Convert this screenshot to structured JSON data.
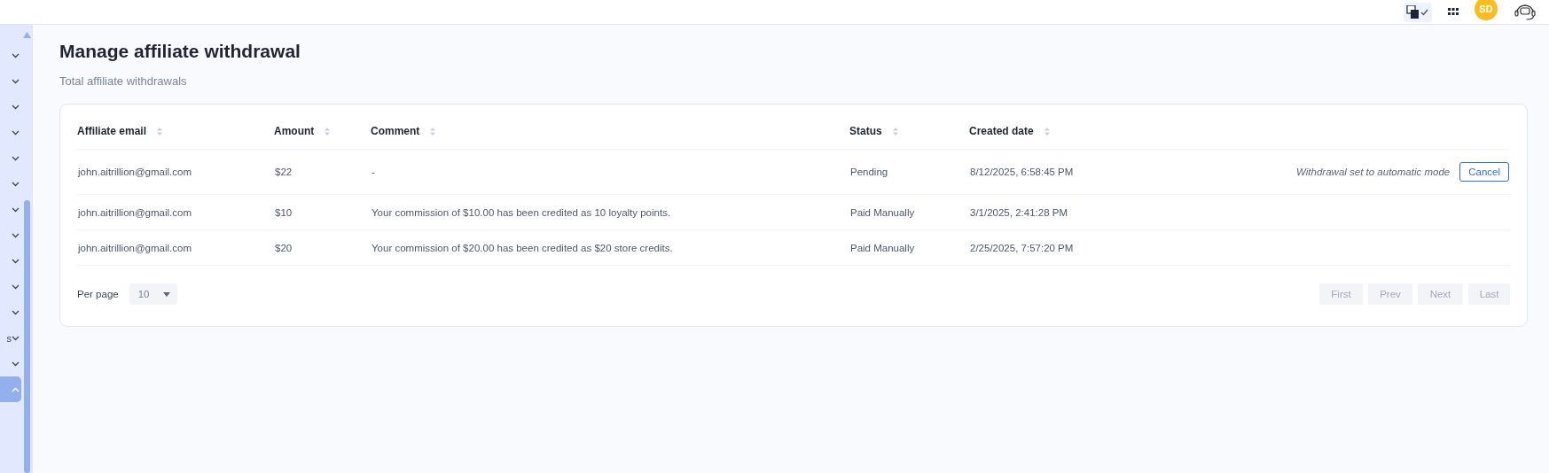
{
  "topbar": {
    "avatar": "SD"
  },
  "sidebar": {
    "items": [
      {
        "expanded": false,
        "selected": false
      },
      {
        "expanded": false,
        "selected": false
      },
      {
        "expanded": false,
        "selected": false
      },
      {
        "expanded": false,
        "selected": false
      },
      {
        "expanded": false,
        "selected": false
      },
      {
        "expanded": false,
        "selected": false
      },
      {
        "expanded": false,
        "selected": false
      },
      {
        "expanded": false,
        "selected": false
      },
      {
        "expanded": false,
        "selected": false
      },
      {
        "expanded": false,
        "selected": false
      },
      {
        "expanded": false,
        "selected": false
      },
      {
        "label": "s",
        "expanded": false,
        "selected": false
      },
      {
        "expanded": false,
        "selected": false
      },
      {
        "expanded": true,
        "selected": true
      }
    ]
  },
  "page": {
    "title": "Manage affiliate withdrawal",
    "subtitle": "Total affiliate withdrawals"
  },
  "table": {
    "columns": [
      "Affiliate email",
      "Amount",
      "Comment",
      "Status",
      "Created date"
    ],
    "rows": [
      {
        "email": "john.aitrillion@gmail.com",
        "amount": "$22",
        "comment": "-",
        "status": "Pending",
        "created": "8/12/2025, 6:58:45 PM",
        "note": "Withdrawal set to automatic mode",
        "action": "Cancel"
      },
      {
        "email": "john.aitrillion@gmail.com",
        "amount": "$10",
        "comment": "Your commission of $10.00 has been credited as 10 loyalty points.",
        "status": "Paid Manually",
        "created": "3/1/2025, 2:41:28 PM"
      },
      {
        "email": "john.aitrillion@gmail.com",
        "amount": "$20",
        "comment": "Your commission of $20.00 has been credited as $20 store credits.",
        "status": "Paid Manually",
        "created": "2/25/2025, 7:57:20 PM"
      }
    ]
  },
  "pagination": {
    "per_page_label": "Per page",
    "per_page": "10",
    "buttons": [
      {
        "label": "First",
        "disabled": true
      },
      {
        "label": "Prev",
        "disabled": true
      },
      {
        "label": "Next",
        "disabled": true
      },
      {
        "label": "Last",
        "disabled": true
      }
    ]
  }
}
